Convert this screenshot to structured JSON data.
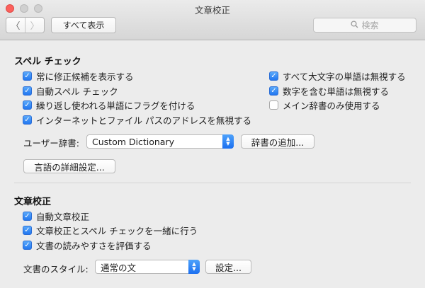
{
  "window": {
    "title": "文章校正"
  },
  "toolbar": {
    "back_glyph": "〈",
    "forward_glyph": "〉",
    "show_all_label": "すべて表示",
    "search_placeholder": "検索"
  },
  "spelling": {
    "heading": "スペル チェック",
    "left_options": [
      {
        "label": "常に修正候補を表示する",
        "checked": true
      },
      {
        "label": "自動スペル チェック",
        "checked": true
      },
      {
        "label": "繰り返し使われる単語にフラグを付ける",
        "checked": true
      },
      {
        "label": "インターネットとファイル パスのアドレスを無視する",
        "checked": true
      }
    ],
    "right_options": [
      {
        "label": "すべて大文字の単語は無視する",
        "checked": true
      },
      {
        "label": "数字を含む単語は無視する",
        "checked": true
      },
      {
        "label": "メイン辞書のみ使用する",
        "checked": false
      }
    ],
    "user_dictionary_label": "ユーザー辞書:",
    "user_dictionary_value": "Custom Dictionary",
    "add_dictionary_button": "辞書の追加...",
    "language_settings_button": "言語の詳細設定..."
  },
  "grammar": {
    "heading": "文章校正",
    "options": [
      {
        "label": "自動文章校正",
        "checked": true
      },
      {
        "label": "文章校正とスペル チェックを一緒に行う",
        "checked": true
      },
      {
        "label": "文書の読みやすさを評価する",
        "checked": true
      }
    ],
    "style_label": "文書のスタイル:",
    "style_value": "通常の文",
    "settings_button": "設定..."
  },
  "colors": {
    "accent": "#2377f0",
    "close": "#fc605c"
  },
  "checkmark_glyph": "✓"
}
